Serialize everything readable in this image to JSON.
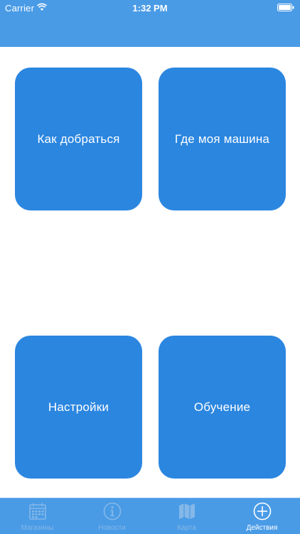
{
  "status_bar": {
    "carrier": "Carrier",
    "time": "1:32 PM"
  },
  "actions": [
    {
      "label": "Как добраться"
    },
    {
      "label": "Где моя машина"
    },
    {
      "label": "Настройки"
    },
    {
      "label": "Обучение"
    }
  ],
  "tabs": [
    {
      "label": "Магазины",
      "icon": "calendar-icon",
      "active": false
    },
    {
      "label": "Новости",
      "icon": "info-icon",
      "active": false
    },
    {
      "label": "Карта",
      "icon": "map-icon",
      "active": false
    },
    {
      "label": "Действия",
      "icon": "plus-circle-icon",
      "active": true
    }
  ],
  "colors": {
    "header": "#4a9be6",
    "tile": "#2b86e0",
    "tab_inactive": "#84b8e8",
    "tab_active": "#ffffff"
  }
}
